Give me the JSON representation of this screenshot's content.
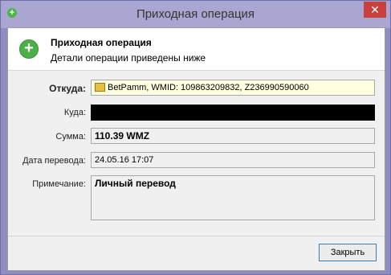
{
  "window": {
    "title": "Приходная операция",
    "close_glyph": "✕",
    "app_icon": "green-plus-icon"
  },
  "header": {
    "title": "Приходная операция",
    "subtitle": "Детали операции приведены ниже",
    "icon": "plus-icon"
  },
  "fields": {
    "from": {
      "label": "Откуда:",
      "value": "BetPamm, WMID: 109863209832, Z236990590060",
      "icon": "wallet-icon"
    },
    "to": {
      "label": "Куда:",
      "value": ""
    },
    "amount": {
      "label": "Сумма:",
      "value": "110.39 WMZ"
    },
    "date": {
      "label": "Дата перевода:",
      "value": "24.05.16 17:07"
    },
    "note": {
      "label": "Примечание:",
      "value": "Личный перевод"
    }
  },
  "buttons": {
    "close": "Закрыть"
  },
  "colors": {
    "titlebar": "#a9a7d2",
    "frame": "#8f8dc0",
    "close_button": "#c8413f",
    "from_field_bg": "#ffffe1"
  }
}
